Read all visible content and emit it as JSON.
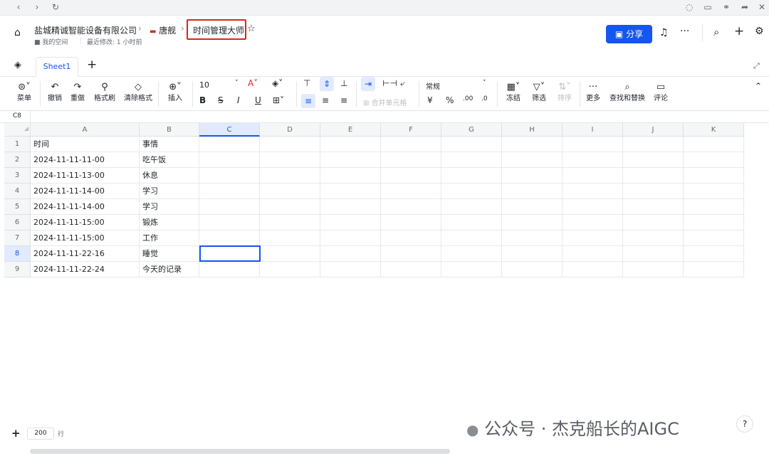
{
  "header": {
    "company": "盐城精诚智能设备有限公司",
    "folder": "唐舰",
    "doc_title": "时间管理大师",
    "space": "我的空间",
    "last_modified": "最近修改: 1 小时前",
    "share_label": "分享"
  },
  "tabs": {
    "sheet1": "Sheet1"
  },
  "toolbar": {
    "menu": "菜单",
    "undo": "撤销",
    "redo": "重做",
    "format_painter": "格式刷",
    "clear_format": "清除格式",
    "insert": "插入",
    "font_size": "10",
    "number_format": "常规",
    "merge": "合并单元格",
    "freeze": "冻结",
    "filter": "筛选",
    "sort": "排序",
    "more": "更多",
    "find_replace": "查找和替换",
    "comment": "评论"
  },
  "formula_bar": {
    "cell_ref": "C8"
  },
  "grid": {
    "columns": [
      "A",
      "B",
      "C",
      "D",
      "E",
      "F",
      "G",
      "H",
      "I",
      "J",
      "K"
    ],
    "rows": [
      {
        "n": "1",
        "a": "时间",
        "b": "事情"
      },
      {
        "n": "2",
        "a": "2024-11-11-11-00",
        "b": "吃午饭"
      },
      {
        "n": "3",
        "a": "2024-11-11-13-00",
        "b": "休息"
      },
      {
        "n": "4",
        "a": "2024-11-11-14-00",
        "b": "学习"
      },
      {
        "n": "5",
        "a": "2024-11-11-14-00",
        "b": "学习"
      },
      {
        "n": "6",
        "a": "2024-11-11-15:00",
        "b": "锻炼"
      },
      {
        "n": "7",
        "a": "2024-11-11-15:00",
        "b": "工作"
      },
      {
        "n": "8",
        "a": "2024-11-11-22-16",
        "b": "睡觉"
      },
      {
        "n": "9",
        "a": "2024-11-11-22-24",
        "b": "今天的记录"
      }
    ]
  },
  "footer": {
    "row_count": "200",
    "row_unit": "行"
  },
  "watermark": "公众号 · 杰克船长的AIGC"
}
